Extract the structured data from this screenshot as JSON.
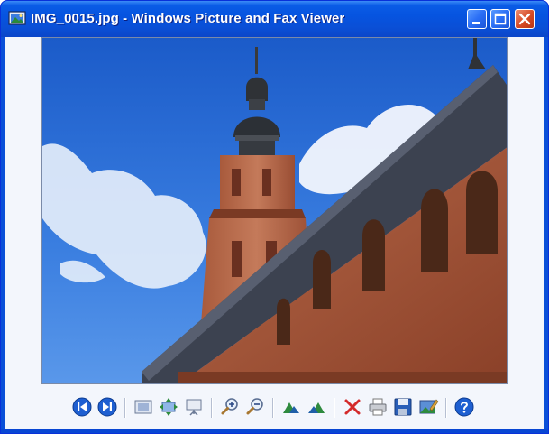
{
  "window": {
    "title": "IMG_0015.jpg - Windows Picture and Fax Viewer",
    "app_icon": "picture-viewer-icon",
    "controls": [
      "minimize-icon",
      "maximize-icon",
      "close-icon"
    ]
  },
  "image": {
    "subject": "church-tower-photo"
  },
  "toolbar": {
    "buttons": [
      {
        "name": "previous-image",
        "icon": "previous-icon"
      },
      {
        "name": "next-image",
        "icon": "next-icon"
      },
      {
        "name": "best-fit",
        "icon": "best-fit-icon"
      },
      {
        "name": "actual-size",
        "icon": "actual-size-icon"
      },
      {
        "name": "slide-show",
        "icon": "slideshow-icon"
      },
      {
        "name": "zoom-in",
        "icon": "zoom-in-icon"
      },
      {
        "name": "zoom-out",
        "icon": "zoom-out-icon"
      },
      {
        "name": "rotate-clockwise",
        "icon": "rotate-clockwise-icon"
      },
      {
        "name": "rotate-counterclockwise",
        "icon": "rotate-counterclockwise-icon"
      },
      {
        "name": "delete",
        "icon": "delete-icon"
      },
      {
        "name": "print",
        "icon": "print-icon"
      },
      {
        "name": "copy-to",
        "icon": "save-icon"
      },
      {
        "name": "edit",
        "icon": "edit-icon"
      },
      {
        "name": "help",
        "icon": "help-icon"
      }
    ]
  },
  "colors": {
    "titlebar": "#0a5ce6",
    "client_bg": "#f3f6fc",
    "close_button": "#d64a25",
    "nav_blue": "#1e5fd1",
    "delete_red": "#d42b2b"
  }
}
